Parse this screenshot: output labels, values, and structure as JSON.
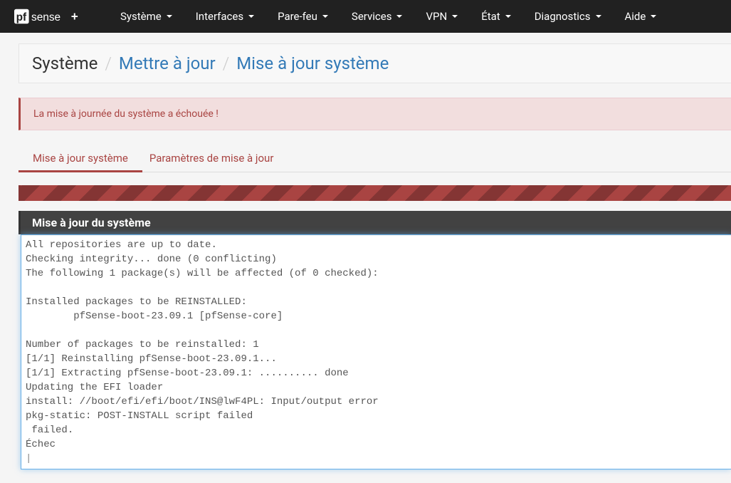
{
  "brand": {
    "name": "pfsense",
    "suffix": "+"
  },
  "nav": {
    "items": [
      {
        "label": "Système"
      },
      {
        "label": "Interfaces"
      },
      {
        "label": "Pare-feu"
      },
      {
        "label": "Services"
      },
      {
        "label": "VPN"
      },
      {
        "label": "État"
      },
      {
        "label": "Diagnostics"
      },
      {
        "label": "Aide"
      }
    ]
  },
  "breadcrumb": {
    "root": "Système",
    "l1": "Mettre à jour",
    "l2": "Mise à jour système"
  },
  "alert": {
    "message": "La mise à journée du système a échouée !"
  },
  "tabs": {
    "items": [
      {
        "label": "Mise à jour système"
      },
      {
        "label": "Paramètres de mise à jour"
      }
    ]
  },
  "panel": {
    "title": "Mise à jour du système"
  },
  "log": "All repositories are up to date.\nChecking integrity... done (0 conflicting)\nThe following 1 package(s) will be affected (of 0 checked):\n\nInstalled packages to be REINSTALLED:\n\tpfSense-boot-23.09.1 [pfSense-core]\n\nNumber of packages to be reinstalled: 1\n[1/1] Reinstalling pfSense-boot-23.09.1...\n[1/1] Extracting pfSense-boot-23.09.1: .......... done\nUpdating the EFI loader\ninstall: //boot/efi/efi/boot/INS@lwF4PL: Input/output error\npkg-static: POST-INSTALL script failed\n failed.\nÉchec"
}
